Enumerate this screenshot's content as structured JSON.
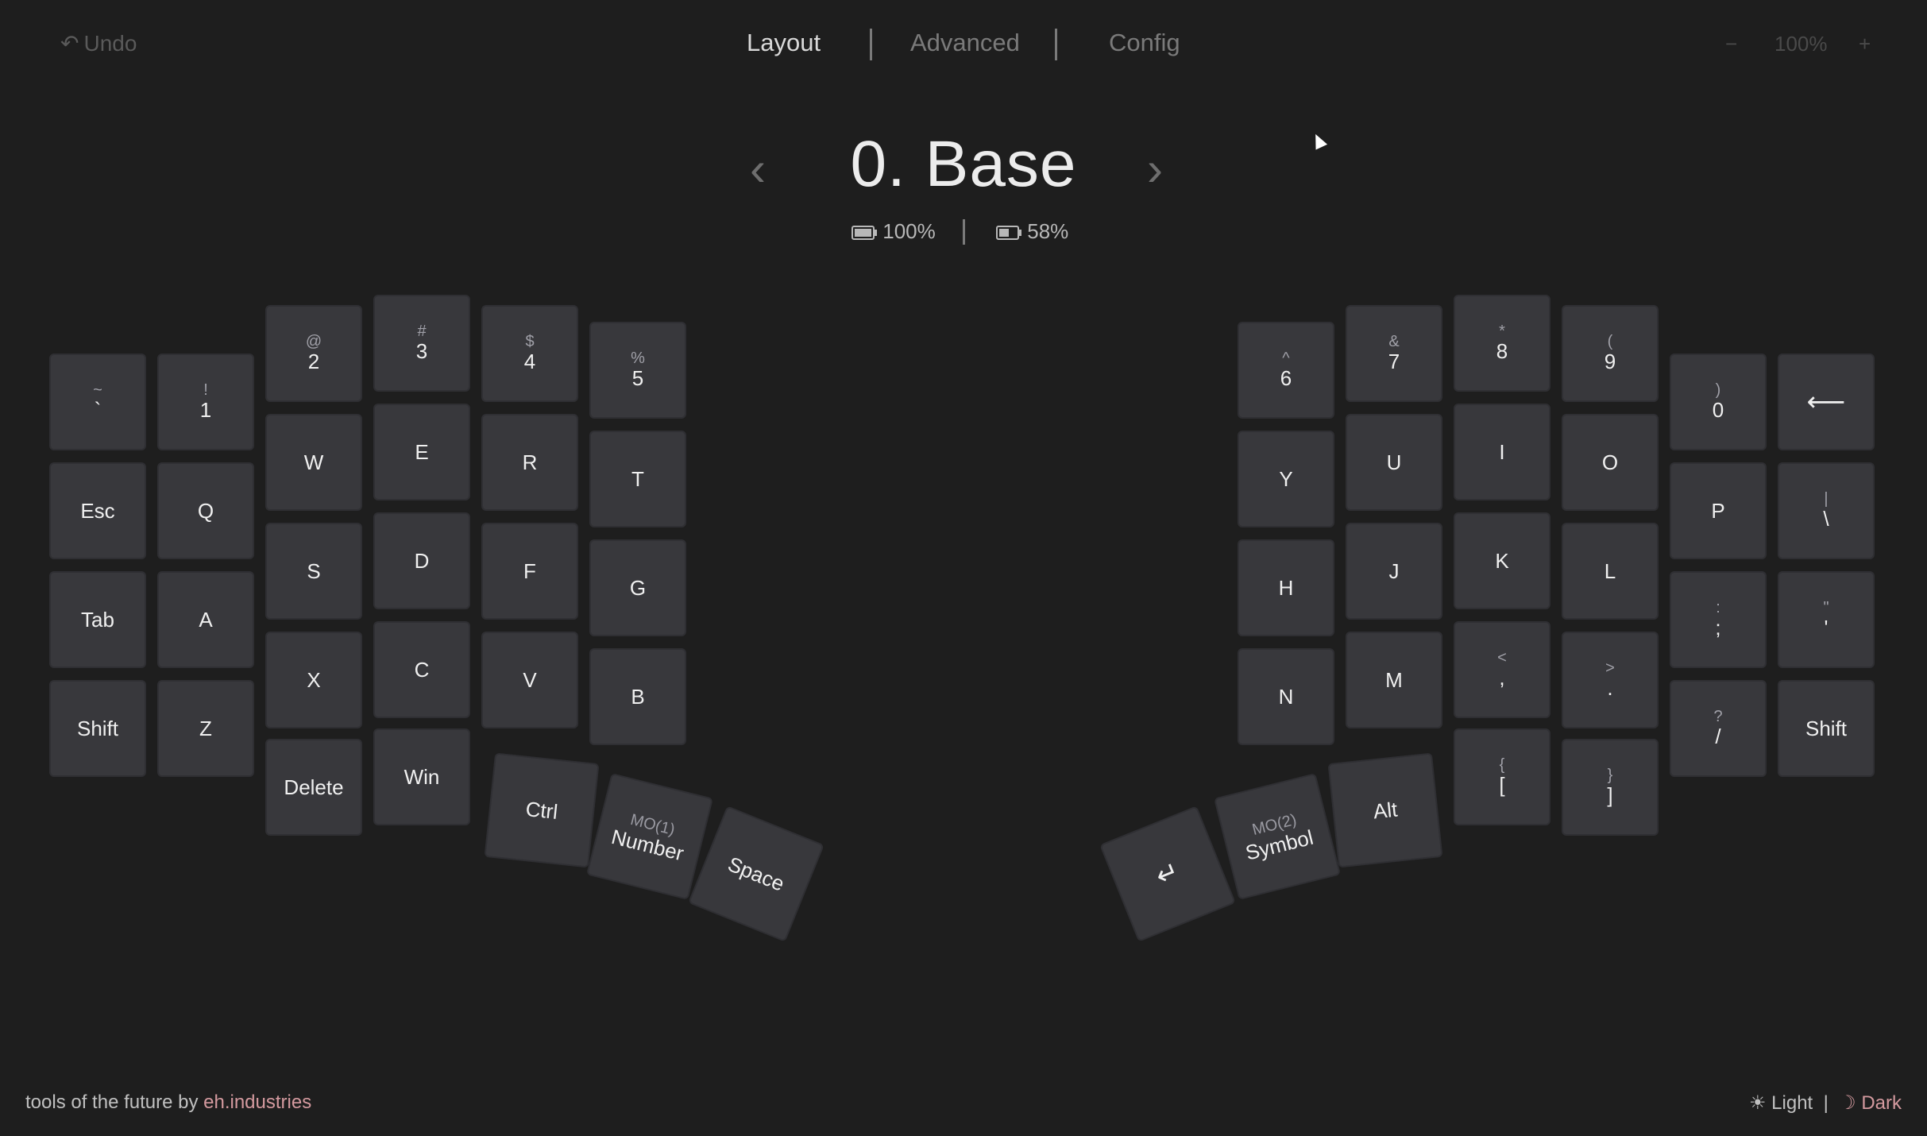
{
  "toolbar": {
    "undo_icon": "undo-arrow-icon",
    "undo_label": "Undo",
    "zoom_minus": "−",
    "zoom_level": "100%",
    "zoom_plus": "+"
  },
  "tabs": [
    {
      "label": "Layout",
      "active": true
    },
    {
      "label": "Advanced",
      "active": false
    },
    {
      "label": "Config",
      "active": false
    }
  ],
  "layer": {
    "title": "0. Base",
    "prev": "‹",
    "next": "›"
  },
  "battery": {
    "left": "100%",
    "right": "58%",
    "left_level": 1.0,
    "right_level": 0.58
  },
  "keys": {
    "tilde": {
      "sub": "~",
      "main": "`"
    },
    "one": {
      "sub": "!",
      "main": "1"
    },
    "two": {
      "sub": "@",
      "main": "2"
    },
    "three": {
      "sub": "#",
      "main": "3"
    },
    "four": {
      "sub": "$",
      "main": "4"
    },
    "five": {
      "sub": "%",
      "main": "5"
    },
    "esc": "Esc",
    "q": "Q",
    "w": "W",
    "e": "E",
    "r": "R",
    "t": "T",
    "tab": "Tab",
    "a": "A",
    "s": "S",
    "d": "D",
    "f": "F",
    "g": "G",
    "shift_l": "Shift",
    "z": "Z",
    "x": "X",
    "c": "C",
    "v": "V",
    "b": "B",
    "delete": "Delete",
    "win": "Win",
    "ctrl": "Ctrl",
    "number": {
      "sub": "MO(1)",
      "main": "Number"
    },
    "space": "Space",
    "six": {
      "sub": "^",
      "main": "6"
    },
    "seven": {
      "sub": "&",
      "main": "7"
    },
    "eight": {
      "sub": "*",
      "main": "8"
    },
    "nine": {
      "sub": "(",
      "main": "9"
    },
    "zero": {
      "sub": ")",
      "main": "0"
    },
    "backspace": "⟵",
    "y": "Y",
    "u": "U",
    "i": "I",
    "o": "O",
    "p": "P",
    "backslash": {
      "sub": "|",
      "main": "\\"
    },
    "h": "H",
    "j": "J",
    "k": "K",
    "l": "L",
    "semicolon": {
      "sub": ":",
      "main": ";"
    },
    "quote": {
      "sub": "\"",
      "main": "'"
    },
    "n": "N",
    "m": "M",
    "comma": {
      "sub": "<",
      "main": ","
    },
    "period": {
      "sub": ">",
      "main": "."
    },
    "slash": {
      "sub": "?",
      "main": "/"
    },
    "shift_r": "Shift",
    "lbracket": {
      "sub": "{",
      "main": "["
    },
    "rbracket": {
      "sub": "}",
      "main": "]"
    },
    "alt": "Alt",
    "symbol": {
      "sub": "MO(2)",
      "main": "Symbol"
    },
    "enter": "↵"
  },
  "footer": {
    "text": "tools of the future by ",
    "brand": "eh.industries",
    "light_icon": "☀",
    "light_label": "Light",
    "sep": "|",
    "dark_icon": "☽",
    "dark_label": "Dark"
  }
}
